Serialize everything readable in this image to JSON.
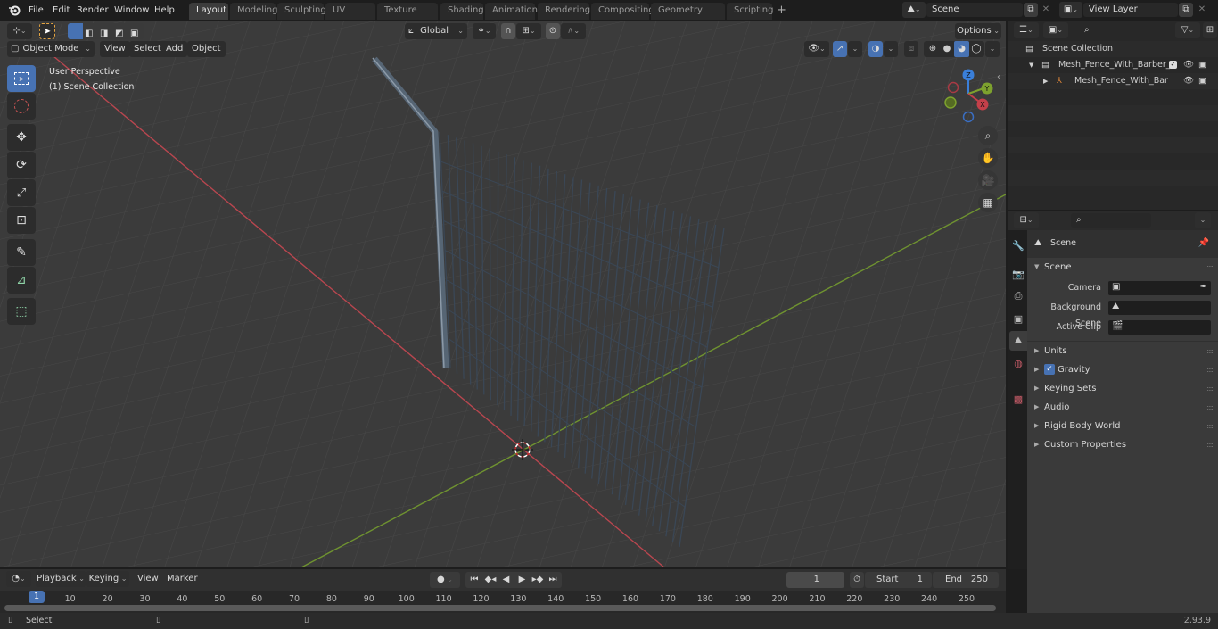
{
  "app": {
    "name": "Blender",
    "version": "2.93.9"
  },
  "menu": [
    "File",
    "Edit",
    "Render",
    "Window",
    "Help"
  ],
  "workspace_tabs": [
    {
      "label": "Layout",
      "active": true
    },
    {
      "label": "Modeling",
      "active": false
    },
    {
      "label": "Sculpting",
      "active": false
    },
    {
      "label": "UV Editing",
      "active": false
    },
    {
      "label": "Texture Paint",
      "active": false
    },
    {
      "label": "Shading",
      "active": false
    },
    {
      "label": "Animation",
      "active": false
    },
    {
      "label": "Rendering",
      "active": false
    },
    {
      "label": "Compositing",
      "active": false
    },
    {
      "label": "Geometry Nodes",
      "active": false
    },
    {
      "label": "Scripting",
      "active": false
    }
  ],
  "add_workspace": "+",
  "scene_selector": {
    "value": "Scene"
  },
  "view_layer_selector": {
    "value": "View Layer"
  },
  "viewport": {
    "mode": "Object Mode",
    "header_menus": [
      "View",
      "Select",
      "Add",
      "Object"
    ],
    "transform_orientation": "Global",
    "options_label": "Options",
    "overlay_text_1": "User Perspective",
    "overlay_text_2": "(1) Scene Collection",
    "gizmo_axes": {
      "x": "X",
      "y": "Y",
      "z": "Z"
    },
    "tools": [
      "select-box",
      "cursor",
      "move",
      "rotate",
      "scale",
      "transform",
      "annotate",
      "measure",
      "add-cube"
    ],
    "nav_buttons": [
      "zoom",
      "pan",
      "camera",
      "ortho-toggle"
    ],
    "shading_mode": "solid",
    "colors": {
      "x_axis": "#c4404a",
      "y_axis": "#7da12e",
      "z_axis": "#3a7fd9",
      "accent": "#4772b3"
    }
  },
  "outliner": {
    "search_placeholder": "",
    "root": "Scene Collection",
    "items": [
      {
        "label": "Mesh_Fence_With_Barber_Wi",
        "type": "collection",
        "checked": true
      },
      {
        "label": "Mesh_Fence_With_Barbe",
        "type": "object"
      }
    ]
  },
  "properties": {
    "search_placeholder": "",
    "context": "Scene",
    "panel_title": "Scene",
    "fields": [
      {
        "label": "Camera",
        "value": ""
      },
      {
        "label": "Background Scene",
        "value": ""
      },
      {
        "label": "Active Clip",
        "value": ""
      }
    ],
    "subpanels": [
      {
        "label": "Units"
      },
      {
        "label": "Gravity",
        "checkbox": true
      },
      {
        "label": "Keying Sets"
      },
      {
        "label": "Audio"
      },
      {
        "label": "Rigid Body World"
      },
      {
        "label": "Custom Properties"
      }
    ]
  },
  "timeline": {
    "menus": [
      "Playback",
      "Keying",
      "View",
      "Marker"
    ],
    "current_frame": "1",
    "start_label": "Start",
    "start": "1",
    "end_label": "End",
    "end": "250",
    "playhead": "1",
    "ticks": [
      "10",
      "20",
      "30",
      "40",
      "50",
      "60",
      "70",
      "80",
      "90",
      "100",
      "110",
      "120",
      "130",
      "140",
      "150",
      "160",
      "170",
      "180",
      "190",
      "200",
      "210",
      "220",
      "230",
      "240",
      "250"
    ]
  },
  "statusbar": {
    "left": "Select",
    "version": "2.93.9"
  }
}
